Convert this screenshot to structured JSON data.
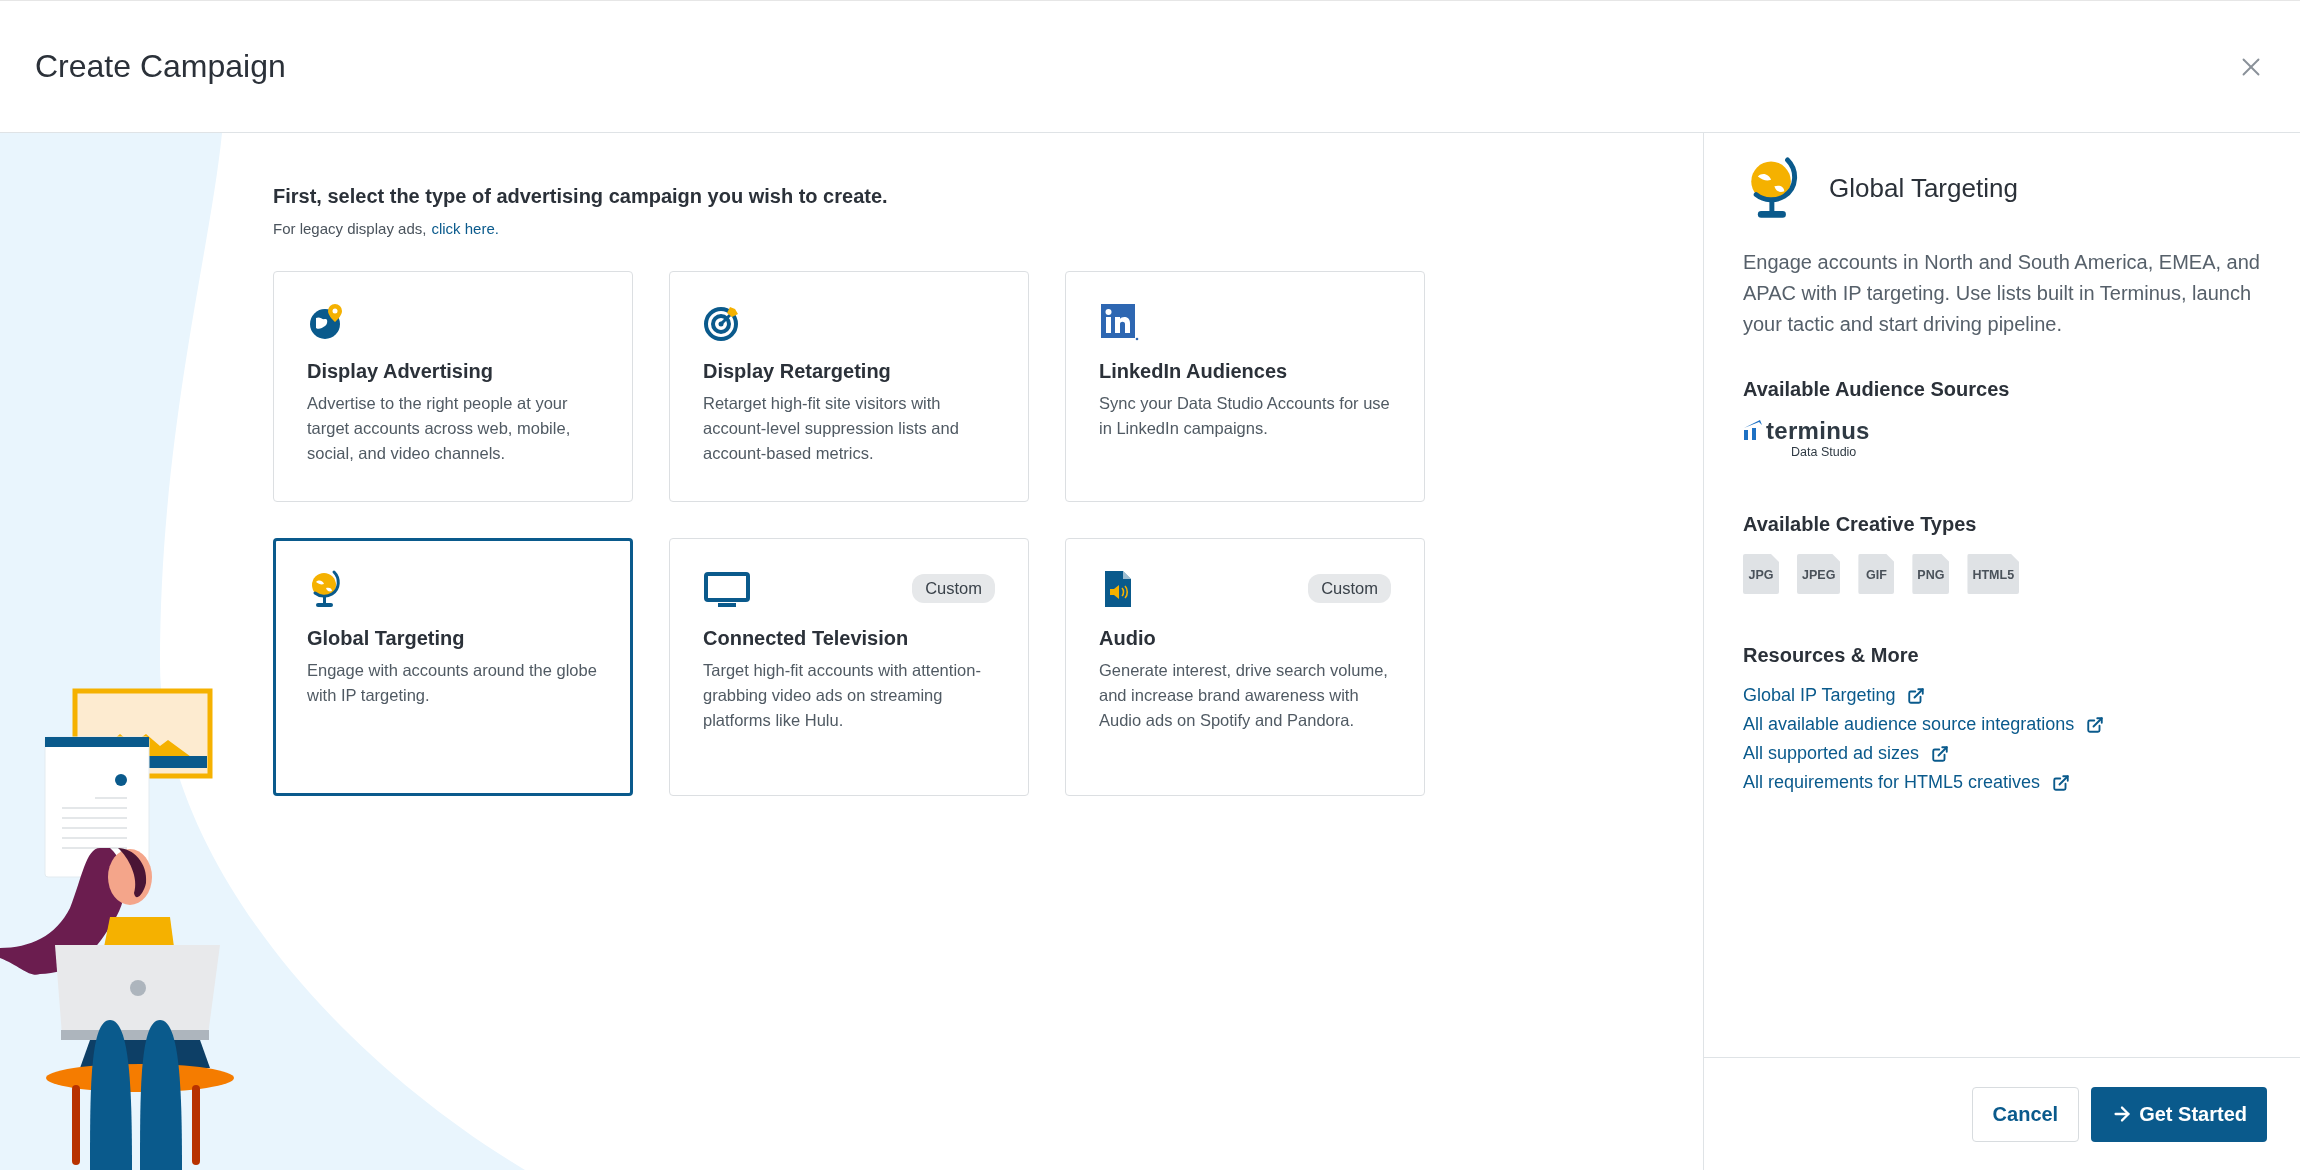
{
  "dialog": {
    "title": "Create Campaign"
  },
  "intro": {
    "heading": "First, select the type of advertising campaign you wish to create.",
    "legacy_text": "For legacy display ads,",
    "legacy_link": "click here."
  },
  "campaign_types": [
    {
      "kind": "globe-pin",
      "title": "Display Advertising",
      "description": "Advertise to the right people at your target accounts across web, mobile, social, and video channels.",
      "selected": false
    },
    {
      "kind": "target",
      "title": "Display Retargeting",
      "description": "Retarget high-fit site visitors with account-level suppression lists and account-based metrics.",
      "selected": false
    },
    {
      "kind": "linkedin",
      "title": "LinkedIn Audiences",
      "description": "Sync your Data Studio Accounts for use in LinkedIn campaigns.",
      "selected": false
    },
    {
      "kind": "globe",
      "title": "Global Targeting",
      "description": "Engage with accounts around the globe with IP targeting.",
      "selected": true
    },
    {
      "kind": "monitor",
      "title": "Connected Television",
      "description": "Target high-fit accounts with attention-grabbing video ads on streaming platforms like Hulu.",
      "badge": "Custom",
      "selected": false
    },
    {
      "kind": "audio",
      "title": "Audio",
      "description": "Generate interest, drive search volume, and increase brand awareness with Audio ads on Spotify and Pandora.",
      "badge": "Custom",
      "selected": false
    }
  ],
  "detail": {
    "title": "Global Targeting",
    "description": "Engage accounts in North and South America, EMEA, and APAC with IP targeting. Use lists built in Terminus, launch your tactic and start driving pipeline.",
    "audience_sources_heading": "Available Audience Sources",
    "audience_source": {
      "name": "terminus",
      "caption": "Data Studio"
    },
    "creative_types_heading": "Available Creative Types",
    "creative_types": [
      "JPG",
      "JPEG",
      "GIF",
      "PNG",
      "HTML5"
    ],
    "resources_heading": "Resources & More",
    "resources": [
      "Global IP Targeting",
      "All available audience source integrations",
      "All supported ad sizes",
      "All requirements for HTML5 creatives"
    ]
  },
  "footer": {
    "buttons": [
      {
        "kind": "secondary",
        "label": "Cancel"
      },
      {
        "kind": "primary",
        "label": "Get Started"
      }
    ]
  }
}
